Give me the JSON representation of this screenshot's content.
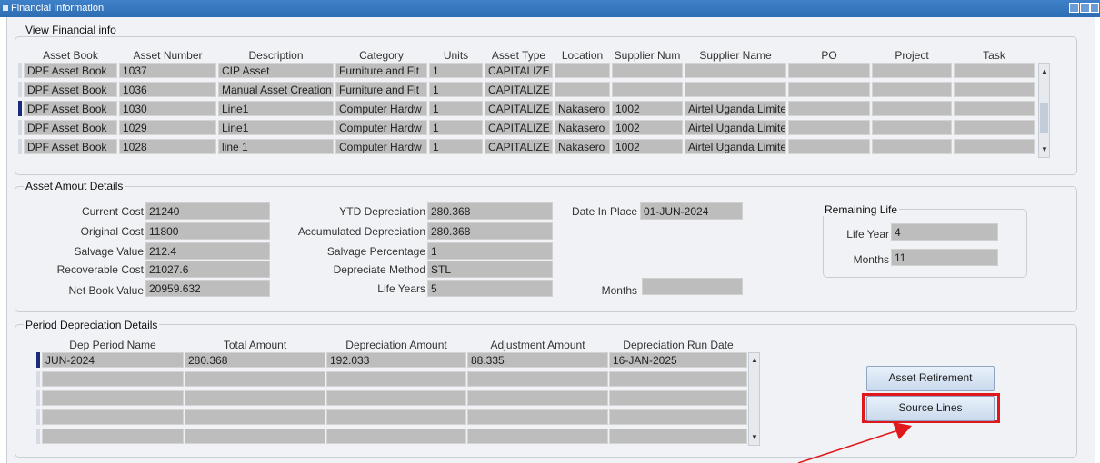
{
  "window": {
    "title": "Financial Information"
  },
  "view_financial": {
    "group_label": "View Financial info",
    "headers": [
      "Asset Book",
      "Asset Number",
      "Description",
      "Category",
      "Units",
      "Asset Type",
      "Location",
      "Supplier Num",
      "Supplier Name",
      "PO",
      "Project",
      "Task"
    ],
    "rows": [
      [
        "DPF Asset Book",
        "1037",
        "CIP Asset",
        "Furniture and Fit",
        "1",
        "CAPITALIZE",
        "",
        "",
        "",
        "",
        "",
        ""
      ],
      [
        "DPF Asset Book",
        "1036",
        "Manual Asset Creation",
        "Furniture and Fit",
        "1",
        "CAPITALIZE",
        "",
        "",
        "",
        "",
        "",
        ""
      ],
      [
        "DPF Asset Book",
        "1030",
        "Line1",
        "Computer Hardw",
        "1",
        "CAPITALIZE",
        "Nakasero",
        "1002",
        "Airtel Uganda Limite",
        "",
        "",
        ""
      ],
      [
        "DPF Asset Book",
        "1029",
        "Line1",
        "Computer Hardw",
        "1",
        "CAPITALIZE",
        "Nakasero",
        "1002",
        "Airtel Uganda Limite",
        "",
        "",
        ""
      ],
      [
        "DPF Asset Book",
        "1028",
        "line 1",
        "Computer Hardw",
        "1",
        "CAPITALIZE",
        "Nakasero",
        "1002",
        "Airtel Uganda Limite",
        "",
        "",
        ""
      ]
    ],
    "current_row": 2
  },
  "asset_amount": {
    "group_label": "Asset Amout Details",
    "current_cost_label": "Current Cost",
    "current_cost": "21240",
    "original_cost_label": "Original Cost",
    "original_cost": "11800",
    "salvage_value_label": "Salvage Value",
    "salvage_value": "212.4",
    "recoverable_cost_label": "Recoverable Cost",
    "recoverable_cost": "21027.6",
    "net_book_value_label": "Net Book Value",
    "net_book_value": "20959.632",
    "ytd_depreciation_label": "YTD Depreciation",
    "ytd_depreciation": "280.368",
    "accumulated_depreciation_label": "Accumulated Depreciation",
    "accumulated_depreciation": "280.368",
    "salvage_percentage_label": "Salvage Percentage",
    "salvage_percentage": "1",
    "depreciate_method_label": "Depreciate Method",
    "depreciate_method": "STL",
    "life_years_label": "Life Years",
    "life_years": "5",
    "date_in_place_label": "Date In Place",
    "date_in_place": "01-JUN-2024",
    "months_label": "Months",
    "months": "",
    "remaining_life": {
      "group_label": "Remaining Life",
      "life_year_label": "Life Year",
      "life_year": "4",
      "months_label": "Months",
      "months": "11"
    }
  },
  "period_depreciation": {
    "group_label": "Period Depreciation Details",
    "headers": [
      "Dep Period Name",
      "Total Amount",
      "Depreciation Amount",
      "Adjustment Amount",
      "Depreciation Run Date"
    ],
    "rows": [
      [
        "JUN-2024",
        "280.368",
        "192.033",
        "88.335",
        "16-JAN-2025"
      ],
      [
        "",
        "",
        "",
        "",
        ""
      ],
      [
        "",
        "",
        "",
        "",
        ""
      ],
      [
        "",
        "",
        "",
        "",
        ""
      ],
      [
        "",
        "",
        "",
        "",
        ""
      ]
    ]
  },
  "buttons": {
    "asset_retirement": "Asset Retirement",
    "source_lines": "Source Lines"
  },
  "colors": {
    "titlebar": "#2d6cb3",
    "highlight": "#e0181b",
    "field": "#bdbdbd"
  }
}
